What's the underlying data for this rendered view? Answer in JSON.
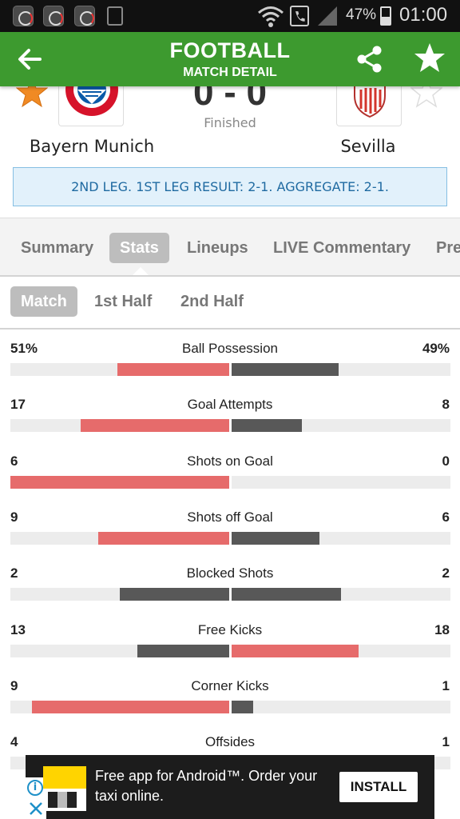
{
  "status_bar": {
    "battery_percent": "47%",
    "battery_level": 0.47,
    "time": "01:00",
    "icons": [
      "sync-notification-icon",
      "sync-notification-icon",
      "sync-notification-icon",
      "battery-saver-icon",
      "wifi-icon",
      "call-icon",
      "signal-icon",
      "battery-icon"
    ]
  },
  "header": {
    "title": "FOOTBALL",
    "subtitle": "MATCH DETAIL",
    "back_icon": "arrow-left-icon",
    "share_icon": "share-icon",
    "favorite_icon": "star-icon",
    "color": "#3d9a2f"
  },
  "match": {
    "home_team": "Bayern Munich",
    "away_team": "Sevilla",
    "home_score": "0",
    "score_separator": "-",
    "away_score": "0",
    "status": "Finished",
    "home_favorite": true,
    "away_favorite": false,
    "leg_note": "2ND LEG. 1ST LEG RESULT: 2-1. AGGREGATE: 2-1."
  },
  "tabs": [
    {
      "label": "Summary",
      "active": false
    },
    {
      "label": "Stats",
      "active": true
    },
    {
      "label": "Lineups",
      "active": false
    },
    {
      "label": "LIVE Commentary",
      "active": false
    },
    {
      "label": "Pre",
      "active": false
    }
  ],
  "periods": [
    {
      "label": "Match",
      "active": true
    },
    {
      "label": "1st Half",
      "active": false
    },
    {
      "label": "2nd Half",
      "active": false
    }
  ],
  "stats": [
    {
      "label": "Ball Possession",
      "home": "51%",
      "away": "49%",
      "home_value": 51,
      "away_value": 49
    },
    {
      "label": "Goal Attempts",
      "home": "17",
      "away": "8",
      "home_value": 17,
      "away_value": 8
    },
    {
      "label": "Shots on Goal",
      "home": "6",
      "away": "0",
      "home_value": 6,
      "away_value": 0
    },
    {
      "label": "Shots off Goal",
      "home": "9",
      "away": "6",
      "home_value": 9,
      "away_value": 6
    },
    {
      "label": "Blocked Shots",
      "home": "2",
      "away": "2",
      "home_value": 2,
      "away_value": 2
    },
    {
      "label": "Free Kicks",
      "home": "13",
      "away": "18",
      "home_value": 13,
      "away_value": 18
    },
    {
      "label": "Corner Kicks",
      "home": "9",
      "away": "1",
      "home_value": 9,
      "away_value": 1
    },
    {
      "label": "Offsides",
      "home": "4",
      "away": "1",
      "home_value": 4,
      "away_value": 1
    }
  ],
  "colors": {
    "leading_bar": "#e66b6b",
    "trailing_bar": "#585858",
    "track": "#ececec",
    "leg_note_bg": "#e2f1fb",
    "leg_note_text": "#1f6aa1"
  },
  "ad": {
    "text": "Free app for Android™. Order your taxi online.",
    "button": "INSTALL"
  }
}
